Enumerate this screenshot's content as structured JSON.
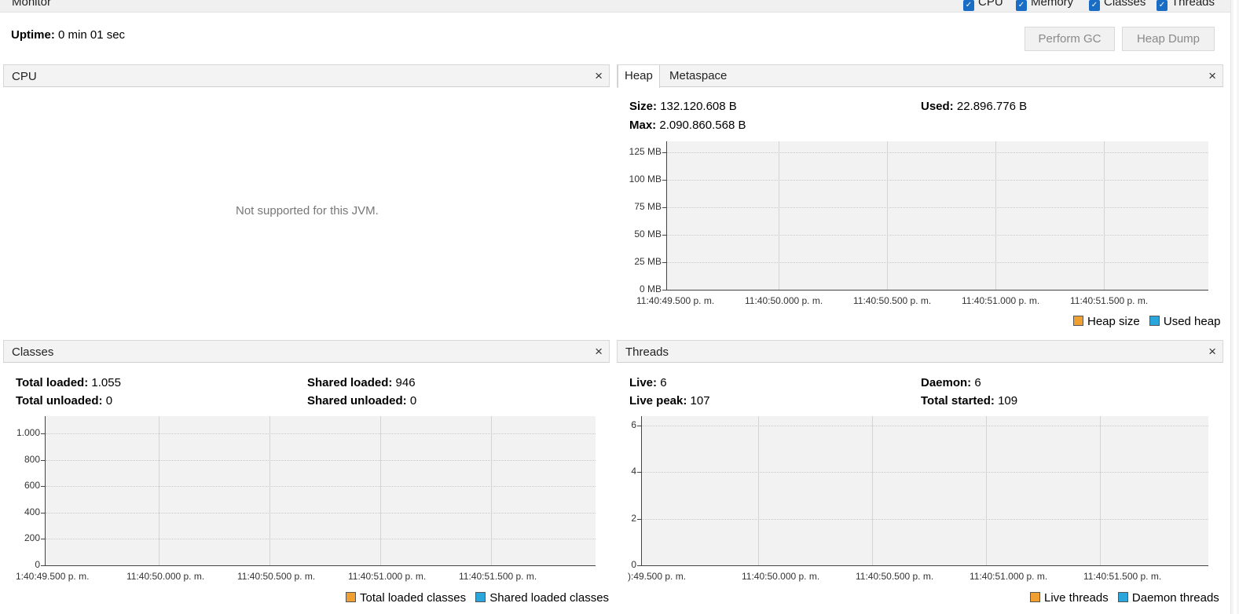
{
  "monitor": {
    "title": "Monitor",
    "checkboxes": [
      {
        "label": "CPU",
        "checked": true
      },
      {
        "label": "Memory",
        "checked": true
      },
      {
        "label": "Classes",
        "checked": true
      },
      {
        "label": "Threads",
        "checked": true
      }
    ],
    "uptime_label": "Uptime:",
    "uptime_value": "0 min 01 sec",
    "perform_gc": "Perform GC",
    "heap_dump": "Heap Dump"
  },
  "cpu": {
    "title": "CPU",
    "close": "×",
    "message": "Not supported for this JVM."
  },
  "memory": {
    "tabs": [
      "Heap",
      "Metaspace"
    ],
    "close": "×",
    "size_label": "Size:",
    "size_value": "132.120.608 B",
    "used_label": "Used:",
    "used_value": "22.896.776 B",
    "max_label": "Max:",
    "max_value": "2.090.860.568 B",
    "y_ticks": [
      "125 MB",
      "100 MB",
      "75 MB",
      "50 MB",
      "25 MB",
      "0 MB"
    ],
    "x_ticks": [
      "11:40:49.500 p. m.",
      "11:40:50.000 p. m.",
      "11:40:50.500 p. m.",
      "11:40:51.000 p. m.",
      "11:40:51.500 p. m."
    ],
    "legend": [
      {
        "label": "Heap size",
        "color": "#f0a030"
      },
      {
        "label": "Used heap",
        "color": "#2ba6dc"
      }
    ]
  },
  "classes": {
    "title": "Classes",
    "close": "×",
    "total_loaded_label": "Total loaded:",
    "total_loaded_value": "1.055",
    "total_unloaded_label": "Total unloaded:",
    "total_unloaded_value": "0",
    "shared_loaded_label": "Shared loaded:",
    "shared_loaded_value": "946",
    "shared_unloaded_label": "Shared unloaded:",
    "shared_unloaded_value": "0",
    "y_ticks": [
      "1.000",
      "800",
      "600",
      "400",
      "200",
      "0"
    ],
    "x_ticks": [
      "1:40:49.500 p. m.",
      "11:40:50.000 p. m.",
      "11:40:50.500 p. m.",
      "11:40:51.000 p. m.",
      "11:40:51.500 p. m."
    ],
    "legend": [
      {
        "label": "Total loaded classes",
        "color": "#f0a030"
      },
      {
        "label": "Shared loaded classes",
        "color": "#2ba6dc"
      }
    ]
  },
  "threads": {
    "title": "Threads",
    "close": "×",
    "live_label": "Live:",
    "live_value": "6",
    "live_peak_label": "Live peak:",
    "live_peak_value": "107",
    "daemon_label": "Daemon:",
    "daemon_value": "6",
    "total_started_label": "Total started:",
    "total_started_value": "109",
    "y_ticks": [
      "6",
      "4",
      "2",
      "0"
    ],
    "x_ticks": [
      "):49.500 p. m.",
      "11:40:50.000 p. m.",
      "11:40:50.500 p. m.",
      "11:40:51.000 p. m.",
      "11:40:51.500 p. m."
    ],
    "legend": [
      {
        "label": "Live threads",
        "color": "#f0a030"
      },
      {
        "label": "Daemon threads",
        "color": "#2ba6dc"
      }
    ]
  }
}
